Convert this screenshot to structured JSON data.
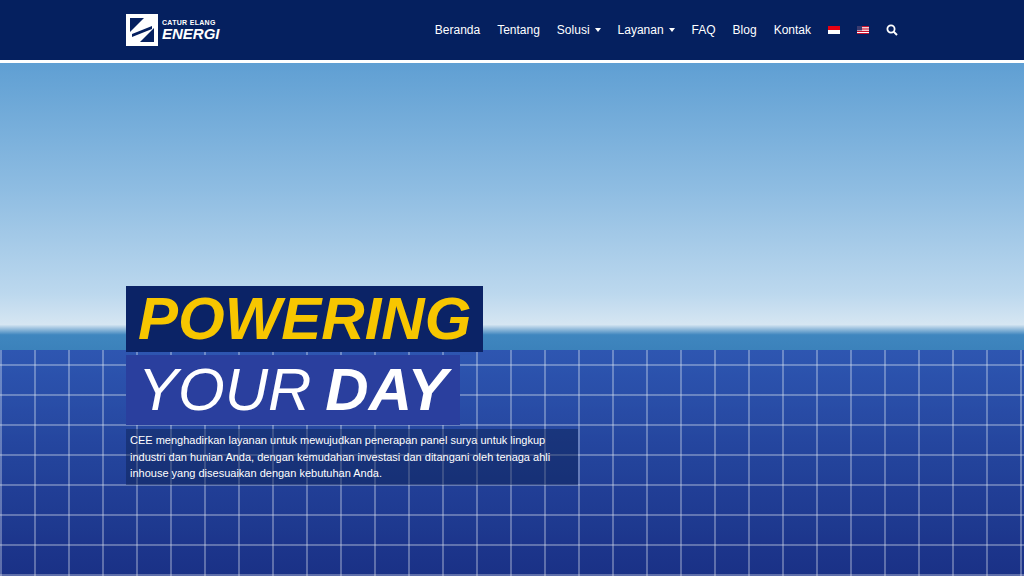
{
  "logo": {
    "top": "CATUR ELANG",
    "bottom": "ENERGI"
  },
  "nav": [
    {
      "label": "Beranda",
      "dropdown": false
    },
    {
      "label": "Tentang",
      "dropdown": false
    },
    {
      "label": "Solusi",
      "dropdown": true
    },
    {
      "label": "Layanan",
      "dropdown": true
    },
    {
      "label": "FAQ",
      "dropdown": false
    },
    {
      "label": "Blog",
      "dropdown": false
    },
    {
      "label": "Kontak",
      "dropdown": false
    }
  ],
  "hero": {
    "line1": "POWERING",
    "line2_light": "YOUR",
    "line2_bold": "DAY",
    "description": "CEE menghadirkan layanan untuk mewujudkan penerapan panel surya untuk lingkup industri dan hunian Anda, dengan kemudahan investasi dan ditangani oleh tenaga ahli inhouse yang disesuaikan dengan kebutuhan Anda."
  }
}
